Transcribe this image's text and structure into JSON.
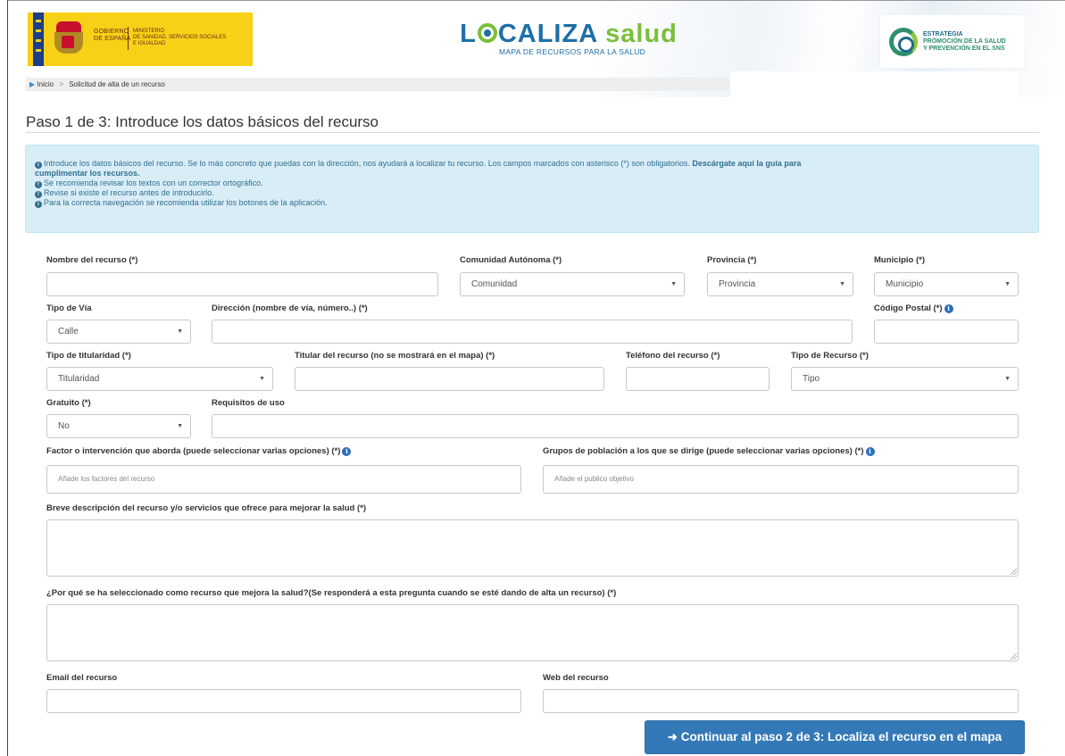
{
  "header": {
    "gov_line1": "GOBIERNO\nDE ESPAÑA",
    "gov_line2": "MINISTERIO\nDE SANIDAD, SERVICIOS SOCIALES\nE IGUALDAD",
    "brand_a": "L",
    "brand_b": "CALIZA",
    "brand_c": "salud",
    "brand_sub": "MAPA DE RECURSOS PARA LA SALUD",
    "strategy_l1": "ESTRATEGIA",
    "strategy_l2": "PROMOCIÓN DE LA SALUD",
    "strategy_l3": "Y PREVENCIÓN EN EL SNS"
  },
  "breadcrumb": {
    "home": "Inicio",
    "current": "Solicitud de alta de un recurso"
  },
  "page_title": "Paso 1 de 3: Introduce los datos básicos del recurso",
  "info": {
    "line1_text": "Introduce los datos básicos del recurso. Se lo más concreto que puedas con la dirección, nos ayudará a localizar tu recurso. Los campos marcados con asterisco (*) son obligatorios. ",
    "line1_bold": "Descárgate aquí la guía para",
    "line2_bold": "cumplimentar los recursos.",
    "line3": "Se recomienda revisar los textos con un corrector ortográfico.",
    "line4": "Revise si existe el recurso antes de introducirlo.",
    "line5": "Para la correcta navegación se recomienda utilizar los botones de la aplicación."
  },
  "form": {
    "nombre_label": "Nombre del recurso (*)",
    "comunidad_label": "Comunidad Autónoma (*)",
    "comunidad_value": "Comunidad",
    "provincia_label": "Provincia (*)",
    "provincia_value": "Provincia",
    "municipio_label": "Municipio (*)",
    "municipio_value": "Municipio",
    "tipo_via_label": "Tipo de Vía",
    "tipo_via_value": "Calle",
    "direccion_label": "Dirección (nombre de vía, número..) (*)",
    "cp_label": "Código Postal (*)",
    "titularidad_label": "Tipo de titularidad (*)",
    "titularidad_value": "Titularidad",
    "titular_label": "Titular del recurso (no se mostrará en el mapa) (*)",
    "telefono_label": "Teléfono del recurso (*)",
    "tipo_recurso_label": "Tipo de Recurso (*)",
    "tipo_recurso_value": "Tipo",
    "gratuito_label": "Gratuito (*)",
    "gratuito_value": "No",
    "requisitos_label": "Requisitos de uso",
    "factor_label": "Factor o intervención que aborda (puede seleccionar varias opciones) (*)",
    "factor_placeholder": "Añade los factores del recurso",
    "grupos_label": "Grupos de población a los que se dirige (puede seleccionar varias opciones) (*)",
    "grupos_placeholder": "Añade el publico objetivo",
    "descripcion_label": "Breve descripción del recurso y/o servicios que ofrece para mejorar la salud (*)",
    "porque_label": "¿Por qué se ha seleccionado como recurso que mejora la salud?(Se responderá a esta pregunta cuando se esté dando de alta un recurso) (*)",
    "email_label": "Email del recurso",
    "web_label": "Web del recurso"
  },
  "continue_label": "Continuar al paso 2 de 3: Localiza el recurso en el mapa",
  "icons": {
    "info": "info-circle-icon",
    "caret": "chevron-down-icon",
    "arrow": "arrow-right-icon"
  },
  "colors": {
    "primary_button": "#3479b7",
    "info_bg": "#d9edf7",
    "info_text": "#31708f",
    "brand_blue": "#1e6fa8",
    "brand_green": "#7bbf3a"
  }
}
